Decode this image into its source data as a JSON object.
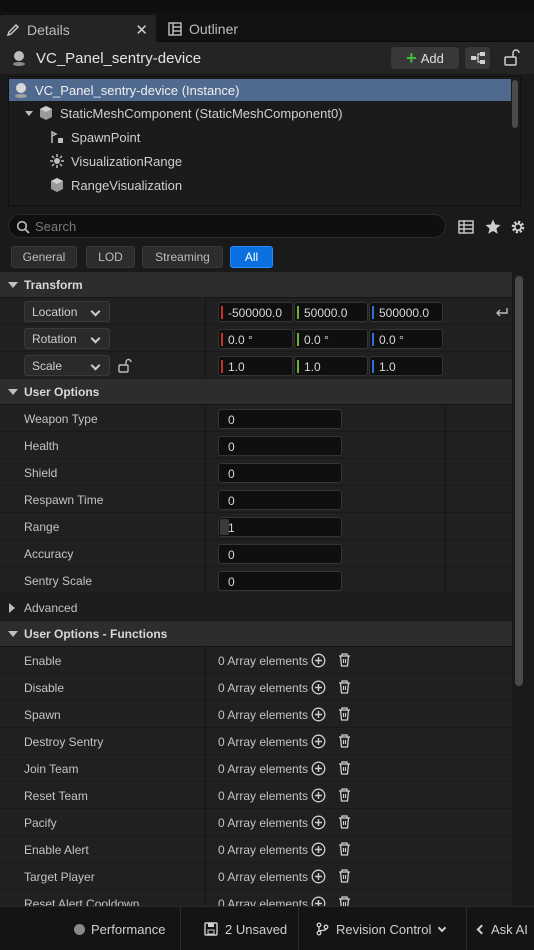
{
  "tabs": [
    {
      "label": "Details",
      "icon": "pencil-icon",
      "active": true
    },
    {
      "label": "Outliner",
      "icon": "outliner-icon",
      "active": false
    }
  ],
  "header": {
    "title": "VC_Panel_sentry-device",
    "add_label": "Add"
  },
  "tree": [
    {
      "label": "VC_Panel_sentry-device (Instance)",
      "icon": "actor-icon",
      "selected": true
    },
    {
      "label": "StaticMeshComponent (StaticMeshComponent0)",
      "icon": "static-mesh-icon"
    },
    {
      "label": "SpawnPoint",
      "icon": "spawn-point-icon"
    },
    {
      "label": "VisualizationRange",
      "icon": "visualization-icon"
    },
    {
      "label": "RangeVisualization",
      "icon": "cube-icon"
    }
  ],
  "search": {
    "placeholder": "Search"
  },
  "filters": [
    "General",
    "LOD",
    "Streaming",
    "All"
  ],
  "active_filter": "All",
  "transform": {
    "title": "Transform",
    "location": {
      "label": "Location",
      "x": "-500000.0",
      "y": "50000.0",
      "z": "500000.0"
    },
    "rotation": {
      "label": "Rotation",
      "x": "0.0 °",
      "y": "0.0 °",
      "z": "0.0 °"
    },
    "scale": {
      "label": "Scale",
      "x": "1.0",
      "y": "1.0",
      "z": "1.0"
    }
  },
  "user_options": {
    "title": "User Options",
    "rows": [
      {
        "label": "Weapon Type",
        "value": "0"
      },
      {
        "label": "Health",
        "value": "0"
      },
      {
        "label": "Shield",
        "value": "0"
      },
      {
        "label": "Respawn Time",
        "value": "0"
      },
      {
        "label": "Range",
        "value": "1"
      },
      {
        "label": "Accuracy",
        "value": "0"
      },
      {
        "label": "Sentry Scale",
        "value": "0"
      }
    ]
  },
  "advanced": {
    "title": "Advanced"
  },
  "functions": {
    "title": "User Options - Functions",
    "array_text": "0 Array elements",
    "rows": [
      "Enable",
      "Disable",
      "Spawn",
      "Destroy Sentry",
      "Join Team",
      "Reset Team",
      "Pacify",
      "Enable Alert",
      "Target Player",
      "Reset Alert Cooldown"
    ]
  },
  "statusbar": {
    "performance": "Performance",
    "unsaved": "2 Unsaved",
    "revision": "Revision Control",
    "ask_ai": "Ask AI"
  },
  "colors": {
    "accent": "#0a70e0",
    "selection": "#4f6a8e",
    "axis_x": "#c8322b",
    "axis_y": "#6bb02e",
    "axis_z": "#2f6fd8",
    "add_plus": "#3fbf3f"
  }
}
